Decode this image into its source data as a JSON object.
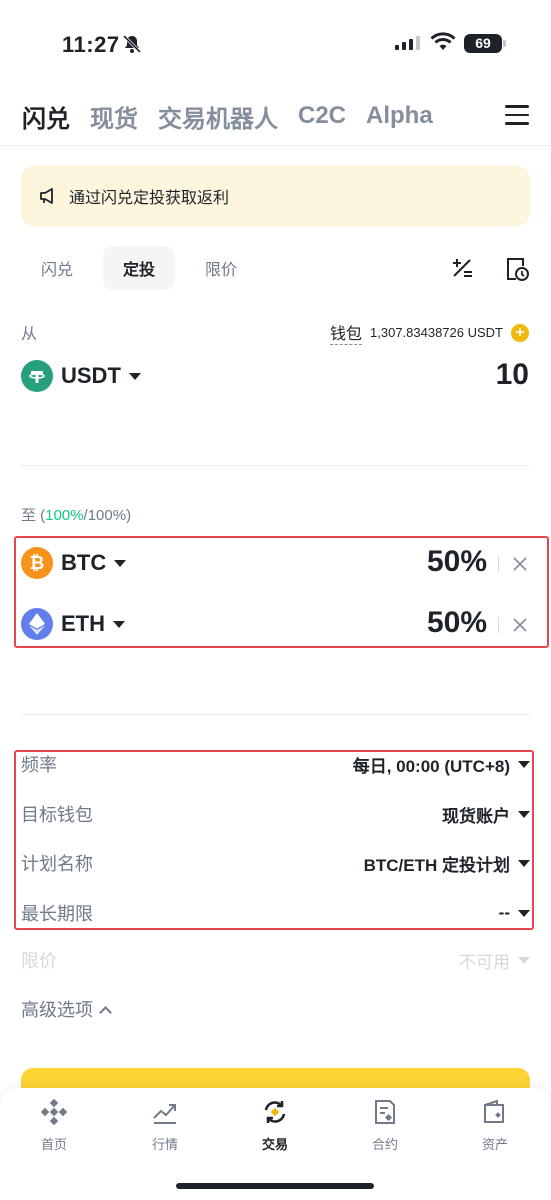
{
  "status_bar": {
    "time": "11:27",
    "battery": "69"
  },
  "top_nav": {
    "tabs": [
      "闪兑",
      "现货",
      "交易机器人",
      "C2C",
      "Alpha"
    ]
  },
  "banner": {
    "text": "通过闪兑定投获取返利"
  },
  "sub_tabs": [
    "闪兑",
    "定投",
    "限价"
  ],
  "from": {
    "label": "从",
    "wallet_label": "钱包",
    "balance": "1,307.83438726 USDT",
    "coin": "USDT",
    "amount": "10"
  },
  "to": {
    "label_prefix": "至 (",
    "allocated": "100%",
    "label_suffix": "/100%)",
    "coins": [
      {
        "name": "BTC",
        "percent": "50%"
      },
      {
        "name": "ETH",
        "percent": "50%"
      }
    ]
  },
  "settings": [
    {
      "label": "频率",
      "value": "每日, 00:00 (UTC+8)"
    },
    {
      "label": "目标钱包",
      "value": "现货账户"
    },
    {
      "label": "计划名称",
      "value": "BTC/ETH 定投计划"
    },
    {
      "label": "最长期限",
      "value": "--"
    },
    {
      "label": "限价",
      "value": "不可用"
    }
  ],
  "advanced_label": "高级选项",
  "bottom_nav": [
    "首页",
    "行情",
    "交易",
    "合约",
    "资产"
  ],
  "colors": {
    "accent": "#fcd535",
    "green": "#0ecb81",
    "highlight_border": "#e8474e",
    "tether": "#26a17b",
    "btc": "#f7931a",
    "eth": "#627eea"
  }
}
